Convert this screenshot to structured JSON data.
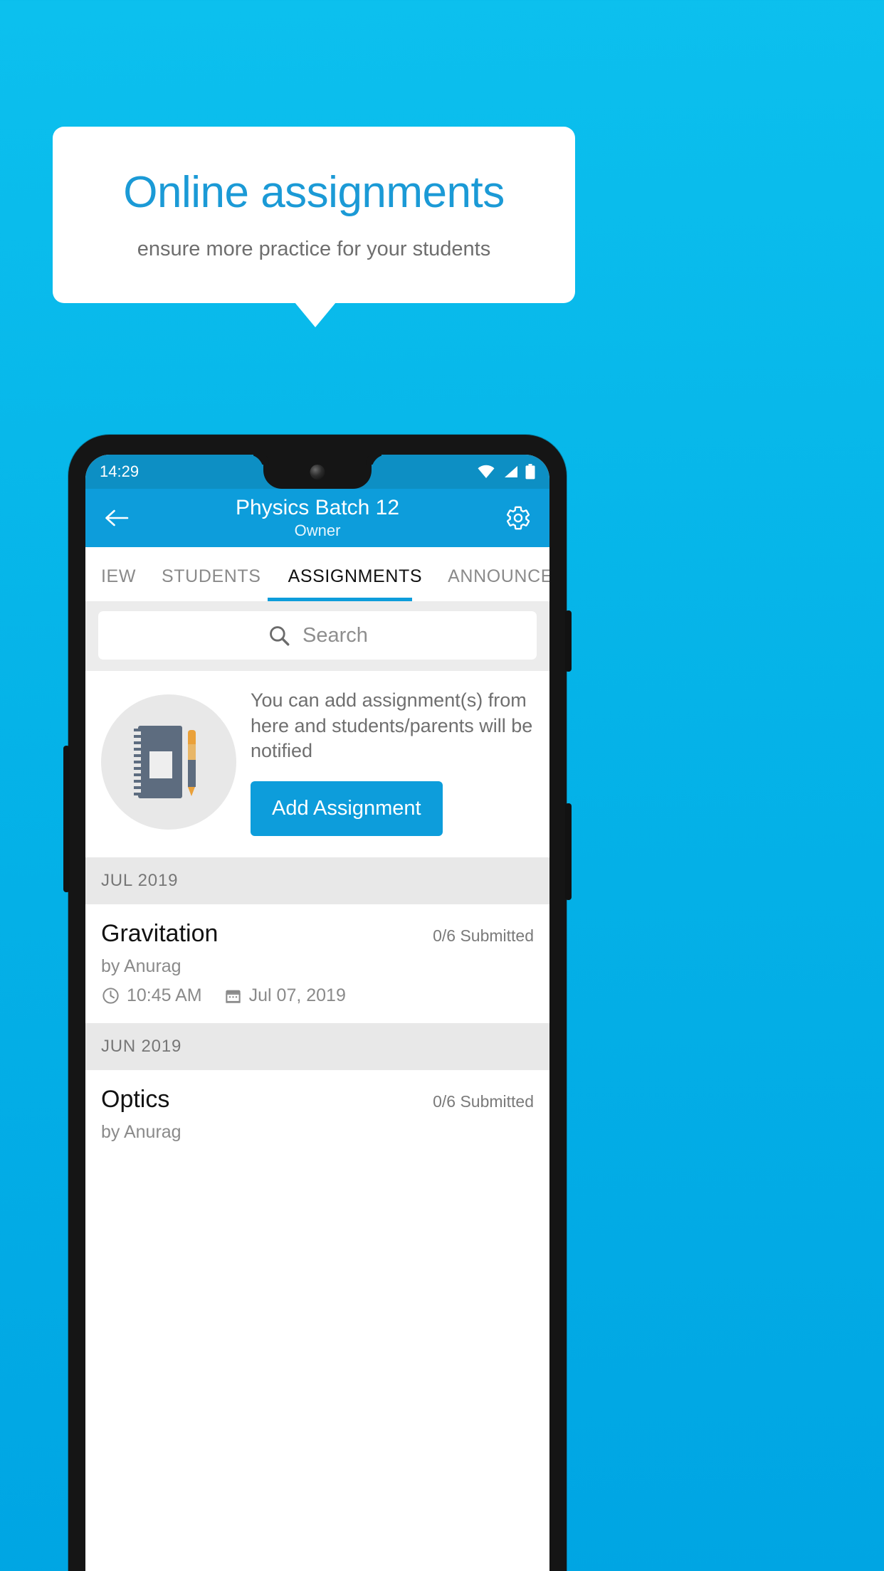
{
  "promo": {
    "title": "Online assignments",
    "subtitle": "ensure more practice for your students"
  },
  "colors": {
    "background": "#05b3e8",
    "accent": "#0d9ddb",
    "statusbar": "#0d8fc4",
    "title_blue": "#1b9ad6"
  },
  "phone": {
    "statusbar": {
      "time": "14:29",
      "icons": [
        "wifi-icon",
        "signal-icon",
        "battery-icon"
      ]
    },
    "appbar": {
      "back_icon": "back-arrow-icon",
      "title": "Physics Batch 12",
      "subtitle": "Owner",
      "settings_icon": "gear-icon"
    },
    "tabs": [
      {
        "label": "IEW",
        "active": false
      },
      {
        "label": "STUDENTS",
        "active": false
      },
      {
        "label": "ASSIGNMENTS",
        "active": true
      },
      {
        "label": "ANNOUNCEM",
        "active": false
      }
    ],
    "search": {
      "icon": "search-icon",
      "placeholder": "Search",
      "value": ""
    },
    "empty_state": {
      "illustration": "notebook-pen-icon",
      "message": "You can add assignment(s) from here and students/parents will be notified",
      "button_label": "Add Assignment"
    },
    "sections": [
      {
        "month": "JUL 2019",
        "items": [
          {
            "title": "Gravitation",
            "count": "0/6 Submitted",
            "author": "by Anurag",
            "time_icon": "clock-icon",
            "time": "10:45 AM",
            "date_icon": "calendar-icon",
            "date": "Jul 07, 2019"
          }
        ]
      },
      {
        "month": "JUN 2019",
        "items": [
          {
            "title": "Optics",
            "count": "0/6 Submitted",
            "author": "by Anurag",
            "time_icon": "clock-icon",
            "time": "",
            "date_icon": "calendar-icon",
            "date": ""
          }
        ]
      }
    ]
  }
}
